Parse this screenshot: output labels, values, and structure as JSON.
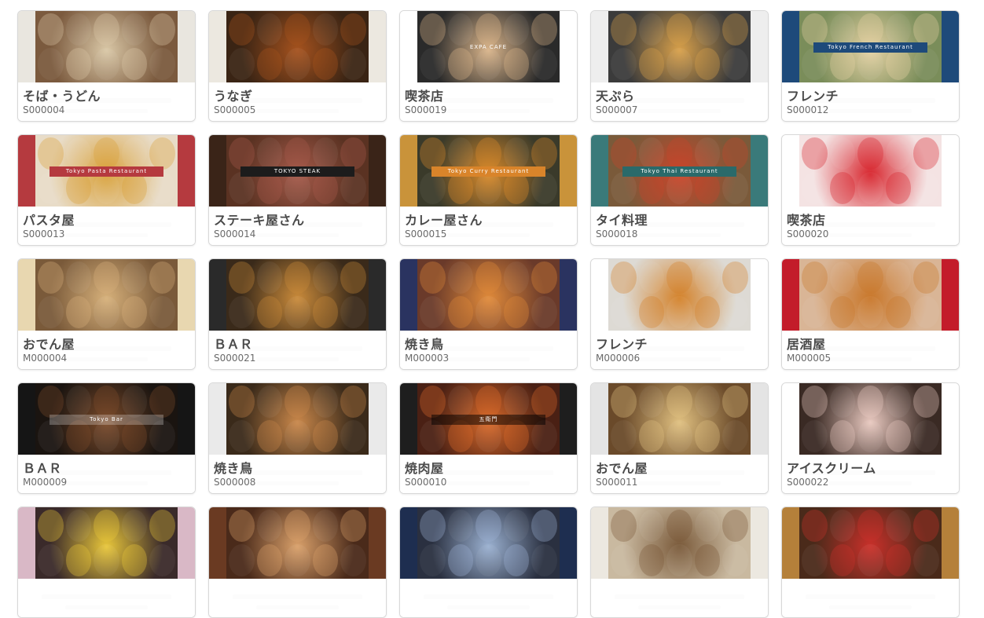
{
  "cards": [
    {
      "title": "そば・うどん",
      "code": "S000004",
      "side": "#e9e6df",
      "photo": "#7b5a3e",
      "accent": "#d9c7a6",
      "banner": "",
      "banner_bg": ""
    },
    {
      "title": "うなぎ",
      "code": "S000005",
      "side": "#ece8e0",
      "photo": "#3a2414",
      "accent": "#a5521e",
      "banner": "",
      "banner_bg": ""
    },
    {
      "title": "喫茶店",
      "code": "S000019",
      "side": "#ffffff",
      "photo": "#2a2a2a",
      "accent": "#d9b48a",
      "banner": "EXPA CAFE",
      "banner_bg": "rgba(0,0,0,0)"
    },
    {
      "title": "天ぷら",
      "code": "S000007",
      "side": "#eeeeee",
      "photo": "#3b3b3b",
      "accent": "#d8a04a",
      "banner": "",
      "banner_bg": ""
    },
    {
      "title": "フレンチ",
      "code": "S000012",
      "side": "#1e4a7a",
      "photo": "#7a8d5a",
      "accent": "#e6d2a4",
      "banner": "Tokyo French Restaurant",
      "banner_bg": "#1e4a7a"
    },
    {
      "title": "パスタ屋",
      "code": "S000013",
      "side": "#b53a3f",
      "photo": "#e8dcc8",
      "accent": "#d9a13a",
      "banner": "Tokyo Pasta Restaurant",
      "banner_bg": "#b53a3f"
    },
    {
      "title": "ステーキ屋さん",
      "code": "S000014",
      "side": "#3a2418",
      "photo": "#5a3222",
      "accent": "#a55a4a",
      "banner": "TOKYO STEAK",
      "banner_bg": "#1c1c1c"
    },
    {
      "title": "カレー屋さん",
      "code": "S000015",
      "side": "#c9933a",
      "photo": "#3a3a2a",
      "accent": "#d98a2a",
      "banner": "Tokyo Curry Restaurant",
      "banner_bg": "#d9842a"
    },
    {
      "title": "タイ料理",
      "code": "S000018",
      "side": "#3a7a7a",
      "photo": "#7a5a3a",
      "accent": "#c9452a",
      "banner": "Tokyo Thai Restaurant",
      "banner_bg": "#2a6a6a"
    },
    {
      "title": "喫茶店",
      "code": "S000020",
      "side": "#ffffff",
      "photo": "#f4e3e3",
      "accent": "#d8262e",
      "banner": "",
      "banner_bg": ""
    },
    {
      "title": "おでん屋",
      "code": "M000004",
      "side": "#e8d7b0",
      "photo": "#7a5a3a",
      "accent": "#d6b07a",
      "banner": "",
      "banner_bg": ""
    },
    {
      "title": "ＢＡＲ",
      "code": "S000021",
      "side": "#2a2a2a",
      "photo": "#3a2a1a",
      "accent": "#c98a3a",
      "banner": "",
      "banner_bg": ""
    },
    {
      "title": "焼き鳥",
      "code": "M000003",
      "side": "#2a3360",
      "photo": "#6a3a2a",
      "accent": "#e08a3a",
      "banner": "",
      "banner_bg": ""
    },
    {
      "title": "フレンチ",
      "code": "M000006",
      "side": "#ffffff",
      "photo": "#dddad4",
      "accent": "#d4822a",
      "banner": "",
      "banner_bg": ""
    },
    {
      "title": "居酒屋",
      "code": "M000005",
      "side": "#c31c2a",
      "photo": "#d9b596",
      "accent": "#c9772a",
      "banner": "",
      "banner_bg": ""
    },
    {
      "title": "ＢＡＲ",
      "code": "M000009",
      "side": "#151515",
      "photo": "#1a1410",
      "accent": "#7a4a2a",
      "banner": "Tokyo Bar",
      "banner_bg": "rgba(255,255,255,0.25)"
    },
    {
      "title": "焼き鳥",
      "code": "S000008",
      "side": "#eaeaea",
      "photo": "#3a2a1a",
      "accent": "#c9874a",
      "banner": "",
      "banner_bg": ""
    },
    {
      "title": "焼肉屋",
      "code": "S000010",
      "side": "#1e1e1e",
      "photo": "#4a2014",
      "accent": "#d96a2a",
      "banner": "五衛門",
      "banner_bg": "rgba(0,0,0,0.5)"
    },
    {
      "title": "おでん屋",
      "code": "S000011",
      "side": "#e4e4e4",
      "photo": "#6a4a2a",
      "accent": "#e0c080",
      "banner": "",
      "banner_bg": ""
    },
    {
      "title": "アイスクリーム",
      "code": "S000022",
      "side": "#ffffff",
      "photo": "#3a2a24",
      "accent": "#e9c9c0",
      "banner": "",
      "banner_bg": ""
    },
    {
      "title": "",
      "code": "",
      "side": "#d9b8c6",
      "photo": "#3a2a2a",
      "accent": "#e8c63a",
      "banner": "",
      "banner_bg": ""
    },
    {
      "title": "",
      "code": "",
      "side": "#6a3a22",
      "photo": "#4a2a1a",
      "accent": "#d9a06a",
      "banner": "",
      "banner_bg": ""
    },
    {
      "title": "",
      "code": "",
      "side": "#1e2e50",
      "photo": "#2a3040",
      "accent": "#9ab0d0",
      "banner": "",
      "banner_bg": ""
    },
    {
      "title": "",
      "code": "",
      "side": "#ece8e0",
      "photo": "#c9b9a0",
      "accent": "#7a5a3a",
      "banner": "",
      "banner_bg": ""
    },
    {
      "title": "",
      "code": "",
      "side": "#b5803a",
      "photo": "#4a2a1a",
      "accent": "#c9302a",
      "banner": "",
      "banner_bg": ""
    }
  ]
}
